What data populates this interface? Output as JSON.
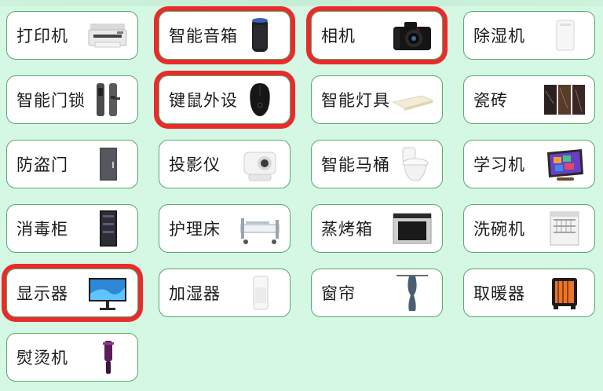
{
  "categories": [
    {
      "label": "打印机",
      "icon": "printer-icon"
    },
    {
      "label": "智能音箱",
      "icon": "smart-speaker-icon"
    },
    {
      "label": "相机",
      "icon": "camera-icon"
    },
    {
      "label": "除湿机",
      "icon": "dehumidifier-icon"
    },
    {
      "label": "智能门锁",
      "icon": "door-lock-icon"
    },
    {
      "label": "键鼠外设",
      "icon": "mouse-icon"
    },
    {
      "label": "智能灯具",
      "icon": "ceiling-light-icon"
    },
    {
      "label": "瓷砖",
      "icon": "tile-icon"
    },
    {
      "label": "防盗门",
      "icon": "security-door-icon"
    },
    {
      "label": "投影仪",
      "icon": "projector-icon"
    },
    {
      "label": "智能马桶",
      "icon": "toilet-icon"
    },
    {
      "label": "学习机",
      "icon": "tablet-icon"
    },
    {
      "label": "消毒柜",
      "icon": "sterilizer-cabinet-icon"
    },
    {
      "label": "护理床",
      "icon": "nursing-bed-icon"
    },
    {
      "label": "蒸烤箱",
      "icon": "steam-oven-icon"
    },
    {
      "label": "洗碗机",
      "icon": "dishwasher-icon"
    },
    {
      "label": "显示器",
      "icon": "monitor-icon"
    },
    {
      "label": "加湿器",
      "icon": "humidifier-icon"
    },
    {
      "label": "窗帘",
      "icon": "curtain-icon"
    },
    {
      "label": "取暖器",
      "icon": "heater-icon"
    },
    {
      "label": "熨烫机",
      "icon": "garment-steamer-icon"
    }
  ],
  "highlighted": [
    "智能音箱",
    "相机",
    "键鼠外设",
    "显示器"
  ],
  "colors": {
    "background": "#d4f8e4",
    "tile_border": "#5aa86a",
    "highlight": "#ea2b2b"
  }
}
